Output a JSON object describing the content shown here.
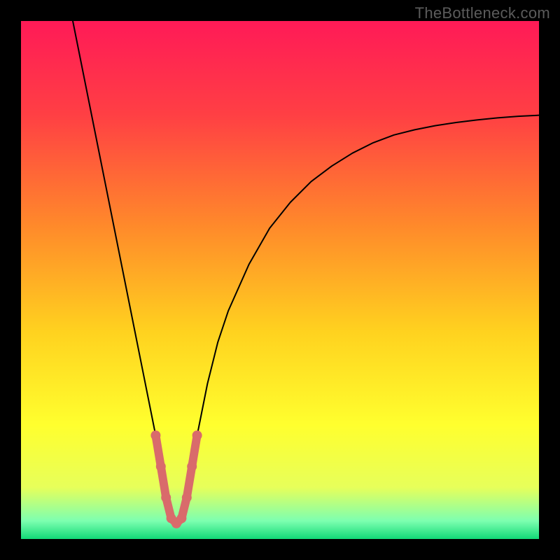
{
  "watermark": "TheBottleneck.com",
  "chart_data": {
    "type": "line",
    "title": "",
    "xlabel": "",
    "ylabel": "",
    "xlim": [
      0,
      100
    ],
    "ylim": [
      0,
      100
    ],
    "grid": false,
    "legend": false,
    "series": [
      {
        "name": "curve",
        "color": "#000000",
        "x": [
          10,
          12,
          14,
          16,
          18,
          20,
          22,
          24,
          25,
          26,
          27,
          28,
          29,
          30,
          31,
          32,
          33,
          34,
          36,
          38,
          40,
          44,
          48,
          52,
          56,
          60,
          64,
          68,
          72,
          76,
          80,
          84,
          88,
          92,
          96,
          100
        ],
        "values": [
          100,
          90,
          80,
          70,
          60,
          50,
          40,
          30,
          25,
          20,
          14,
          8,
          4,
          3,
          4,
          8,
          14,
          20,
          30,
          38,
          44,
          53,
          60,
          65,
          69,
          72,
          74.5,
          76.5,
          78,
          79,
          79.8,
          80.4,
          80.9,
          81.3,
          81.6,
          81.8
        ]
      },
      {
        "name": "valley-highlight",
        "color": "#d96b6b",
        "x": [
          26,
          27,
          28,
          29,
          30,
          31,
          32,
          33,
          34
        ],
        "values": [
          20,
          14,
          8,
          4,
          3,
          4,
          8,
          14,
          20
        ]
      }
    ],
    "background_gradient": {
      "stops": [
        {
          "offset": 0.0,
          "color": "#ff1a57"
        },
        {
          "offset": 0.18,
          "color": "#ff3f44"
        },
        {
          "offset": 0.4,
          "color": "#ff8b2a"
        },
        {
          "offset": 0.6,
          "color": "#ffd21f"
        },
        {
          "offset": 0.78,
          "color": "#ffff2e"
        },
        {
          "offset": 0.9,
          "color": "#e7ff5a"
        },
        {
          "offset": 0.965,
          "color": "#7dffb0"
        },
        {
          "offset": 1.0,
          "color": "#12d977"
        }
      ]
    }
  }
}
